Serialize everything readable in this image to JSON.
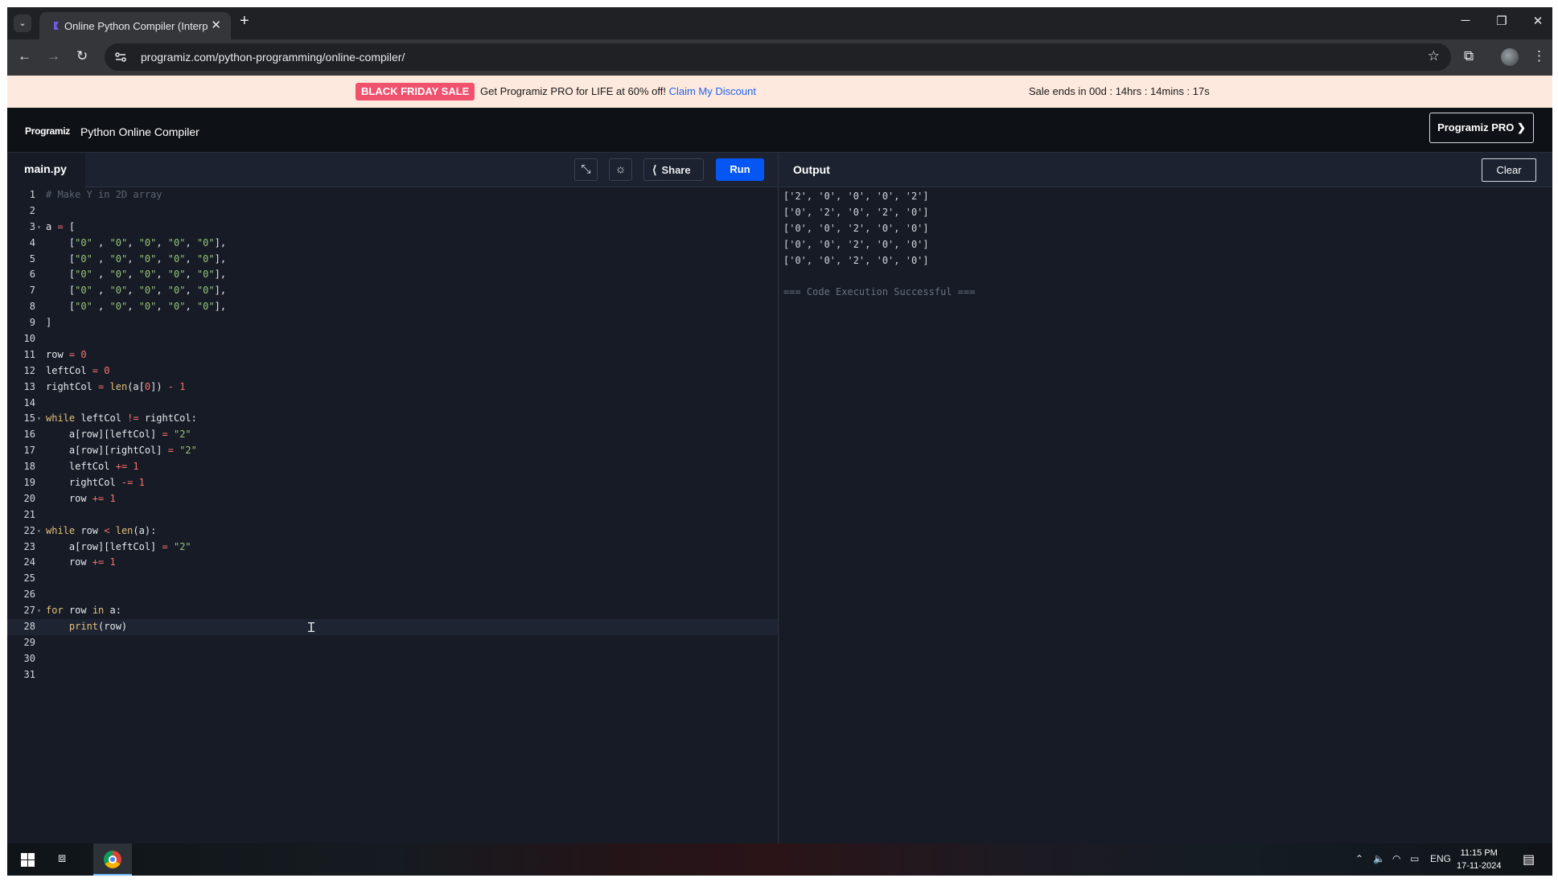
{
  "browser": {
    "tab_title": "Online Python Compiler (Interp",
    "url": "programiz.com/python-programming/online-compiler/"
  },
  "promo": {
    "badge": "BLACK FRIDAY SALE",
    "text": "Get Programiz PRO for LIFE at 60% off!",
    "link": "Claim My Discount",
    "countdown": "Sale ends in 00d : 14hrs : 14mins : 17s"
  },
  "header": {
    "logo": "Programiz",
    "title": "Python Online Compiler",
    "pro_button": "Programiz PRO ❯"
  },
  "editor": {
    "file_tab": "main.py",
    "share_label": "Share",
    "run_label": "Run",
    "lines": [
      "# Make Y in 2D array",
      "",
      "a = [",
      "    [\"0\" , \"0\", \"0\", \"0\", \"0\"],",
      "    [\"0\" , \"0\", \"0\", \"0\", \"0\"],",
      "    [\"0\" , \"0\", \"0\", \"0\", \"0\"],",
      "    [\"0\" , \"0\", \"0\", \"0\", \"0\"],",
      "    [\"0\" , \"0\", \"0\", \"0\", \"0\"],",
      "]",
      "",
      "row = 0",
      "leftCol = 0",
      "rightCol = len(a[0]) - 1",
      "",
      "while leftCol != rightCol:",
      "    a[row][leftCol] = \"2\"",
      "    a[row][rightCol] = \"2\"",
      "    leftCol += 1",
      "    rightCol -= 1",
      "    row += 1",
      "",
      "while row < len(a):",
      "    a[row][leftCol] = \"2\"",
      "    row += 1",
      "",
      "",
      "for row in a:",
      "    print(row)",
      "",
      "",
      ""
    ],
    "fold_lines": [
      3,
      15,
      22,
      27
    ],
    "active_line": 28
  },
  "output": {
    "title": "Output",
    "clear_label": "Clear",
    "lines": [
      "['2', '0', '0', '0', '2']",
      "['0', '2', '0', '2', '0']",
      "['0', '0', '2', '0', '0']",
      "['0', '0', '2', '0', '0']",
      "['0', '0', '2', '0', '0']"
    ],
    "status": "=== Code Execution Successful ==="
  },
  "taskbar": {
    "language": "ENG",
    "time": "11:15 PM",
    "date": "17-11-2024"
  },
  "colors": {
    "run_button": "#0556f3",
    "sale_badge": "#f0516d",
    "promo_bg": "#fde9de",
    "editor_bg": "#161b26",
    "keyword": "#e5c07b",
    "string": "#98c379",
    "number": "#f87171",
    "comment": "#5c6370"
  }
}
